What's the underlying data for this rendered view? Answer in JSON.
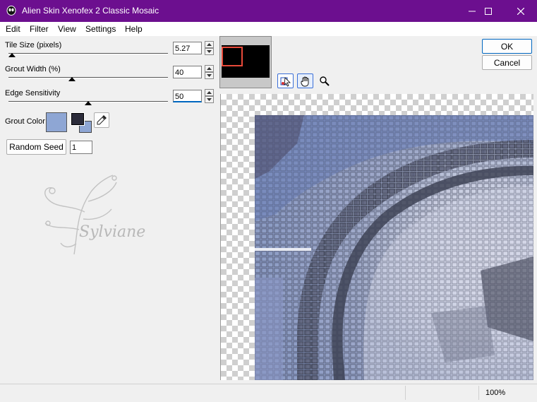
{
  "window": {
    "title": "Alien Skin Xenofex 2 Classic Mosaic"
  },
  "menu": [
    "Edit",
    "Filter",
    "View",
    "Settings",
    "Help"
  ],
  "controls": {
    "tile_size": {
      "label": "Tile Size (pixels)",
      "value": "5.27",
      "slider_fraction": 0.02
    },
    "grout_width": {
      "label": "Grout Width (%)",
      "value": "40",
      "slider_fraction": 0.4
    },
    "edge_sensitivity": {
      "label": "Edge Sensitivity",
      "value": "50",
      "slider_fraction": 0.5
    },
    "grout_color": {
      "label": "Grout Color",
      "color": "#8ea6d4"
    },
    "foreground_swatch": "#2b2b3a",
    "background_swatch": "#8ea6d4",
    "random_seed": {
      "label": "Random Seed",
      "value": "1"
    }
  },
  "watermark": {
    "text": "Sylviane"
  },
  "buttons": {
    "ok": "OK",
    "cancel": "Cancel"
  },
  "tools": [
    "pointer-icon",
    "hand-icon",
    "zoom-icon"
  ],
  "status": {
    "zoom": "100%"
  },
  "colors": {
    "titlebar": "#6c0f8f",
    "navigator_frame": "#e84a3a"
  }
}
